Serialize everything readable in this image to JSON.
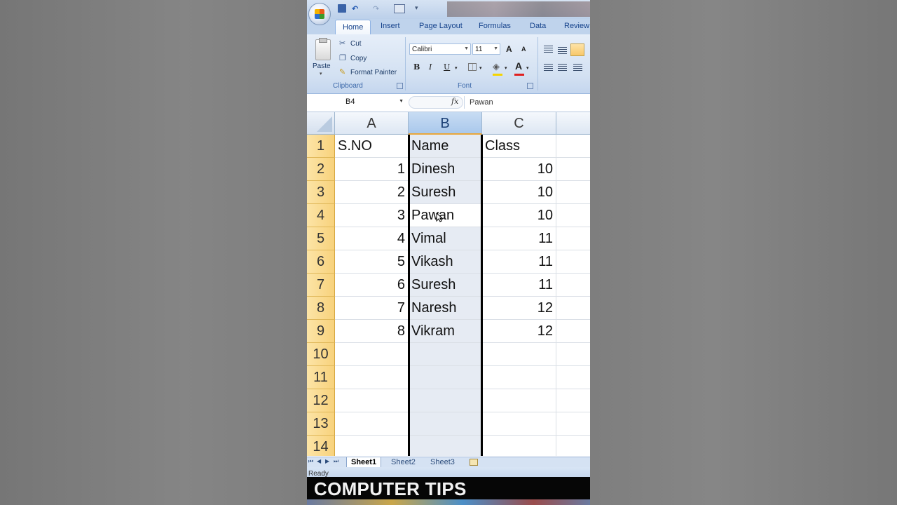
{
  "ribbon": {
    "tabs": [
      {
        "label": "Home",
        "active": true
      },
      {
        "label": "Insert"
      },
      {
        "label": "Page Layout"
      },
      {
        "label": "Formulas"
      },
      {
        "label": "Data"
      },
      {
        "label": "Review"
      }
    ],
    "clipboard": {
      "paste": "Paste",
      "cut": "Cut",
      "copy": "Copy",
      "format_painter": "Format Painter",
      "label": "Clipboard"
    },
    "font": {
      "family": "Calibri",
      "size": "11",
      "bold": "B",
      "italic": "I",
      "underline": "U",
      "grow": "A",
      "shrink": "A",
      "color_btn": "A",
      "label": "Font"
    }
  },
  "formula_bar": {
    "name_box": "B4",
    "fx": "fx",
    "value": "Pawan"
  },
  "sheet": {
    "columns": [
      "A",
      "B",
      "C"
    ],
    "selected_column": "B",
    "row_numbers": [
      "1",
      "2",
      "3",
      "4",
      "5",
      "6",
      "7",
      "8",
      "9",
      "10",
      "11",
      "12",
      "13",
      "14"
    ],
    "header_row": {
      "a": "S.NO",
      "b": "Name",
      "c": "Class"
    },
    "rows": [
      {
        "sno": "1",
        "name": "Dinesh",
        "class": "10"
      },
      {
        "sno": "2",
        "name": "Suresh",
        "class": "10"
      },
      {
        "sno": "3",
        "name": "Pawan",
        "class": "10"
      },
      {
        "sno": "4",
        "name": "Vimal",
        "class": "11"
      },
      {
        "sno": "5",
        "name": "Vikash",
        "class": "11"
      },
      {
        "sno": "6",
        "name": "Suresh",
        "class": "11"
      },
      {
        "sno": "7",
        "name": "Naresh",
        "class": "12"
      },
      {
        "sno": "8",
        "name": "Vikram",
        "class": "12"
      }
    ]
  },
  "sheet_tabs": [
    "Sheet1",
    "Sheet2",
    "Sheet3"
  ],
  "status": "Ready",
  "overlay_text": "COMPUTER TIPS",
  "colors": {
    "ribbon_blue": "#bfd3ec",
    "row_header": "#f8d27c",
    "selected_column": "#a9c8ec",
    "font_color_red": "#e02020",
    "fill_yellow": "#f5d400"
  },
  "icons": [
    "office-button-icon",
    "save-icon",
    "undo-icon",
    "redo-icon",
    "print-preview-icon",
    "paste-icon",
    "cut-icon",
    "copy-icon",
    "format-painter-icon",
    "borders-icon",
    "fill-color-icon",
    "font-color-icon",
    "align-left-icon",
    "align-center-icon",
    "align-right-icon",
    "insert-sheet-icon"
  ]
}
